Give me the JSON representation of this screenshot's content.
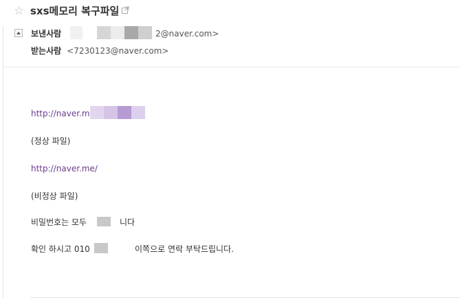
{
  "header": {
    "subject": "sxs메모리 복구파일",
    "from_label": "보낸사람",
    "from_value_suffix": "2@naver.com>",
    "to_label": "받는사람",
    "to_value": "<7230123@naver.com>"
  },
  "body": {
    "link1": "http://naver.me",
    "line_normal": "(정상 파일)",
    "link2": "http://naver.me/",
    "line_abnormal": "(비정상 파일)",
    "password_prefix": "비밀번호는 모두",
    "password_suffix": "니다",
    "contact_prefix": "확인 하시고 010",
    "contact_suffix": "이쪽으로 연락 부탁드립니다."
  },
  "icons": {
    "star": "star-outline-icon",
    "popout": "open-in-new-window-icon",
    "collapse": "collapse-triangle-icon"
  },
  "colors": {
    "link": "#6a3b8f",
    "redact_gray": "#c8c8c8",
    "redact_purple": "#d9cbe8"
  }
}
